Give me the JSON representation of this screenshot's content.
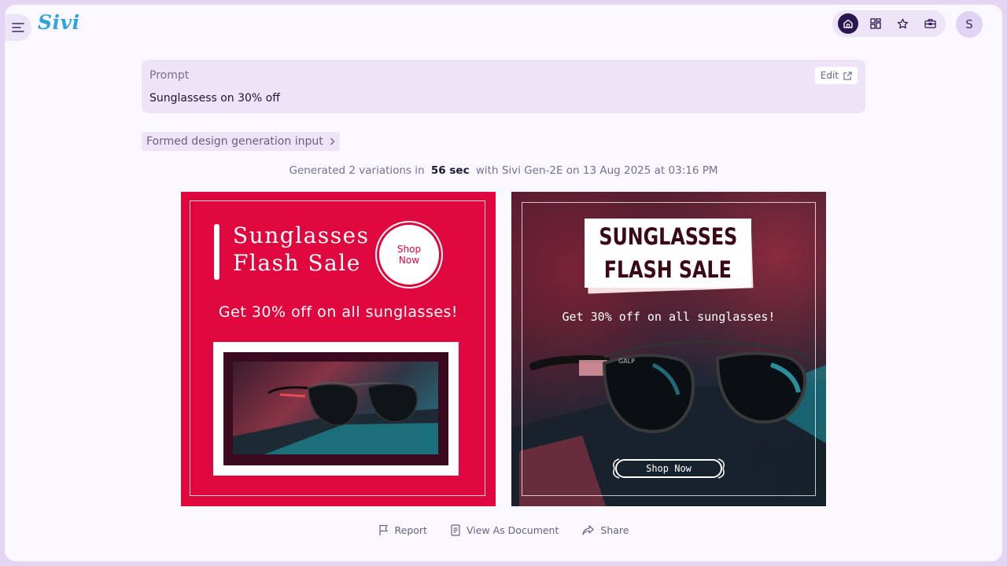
{
  "app": {
    "logo": "Sivi",
    "avatar_initial": "S"
  },
  "nav": {
    "icons": [
      "home-icon",
      "grid-icon",
      "star-icon",
      "briefcase-icon"
    ],
    "active": "home-icon"
  },
  "prompt": {
    "label": "Prompt",
    "text": "Sunglassess on 30% off",
    "edit_label": "Edit"
  },
  "formed_input_label": "Formed design generation input",
  "generation": {
    "prefix": "Generated 2 variations in",
    "duration": "56 sec",
    "suffix": "with Sivi Gen-2E  on 13 Aug 2025 at 03:16 PM"
  },
  "designs": [
    {
      "title_line1": "Sunglasses",
      "title_line2": "Flash Sale",
      "shop_line1": "Shop",
      "shop_line2": "Now",
      "subtitle": "Get 30% off on all sunglasses!",
      "bg_color": "#e0073f"
    },
    {
      "title_line1": "SUNGLASSES",
      "title_line2": "FLASH SALE",
      "subtitle": "Get 30% off on all sunglasses!",
      "cta": "Shop Now",
      "brand_mark": "GALP"
    }
  ],
  "actions": {
    "report": "Report",
    "view_document": "View As Document",
    "share": "Share"
  },
  "colors": {
    "accent": "#2a1650",
    "lavender": "#ede4f8",
    "logo": "#2ea3dd"
  }
}
